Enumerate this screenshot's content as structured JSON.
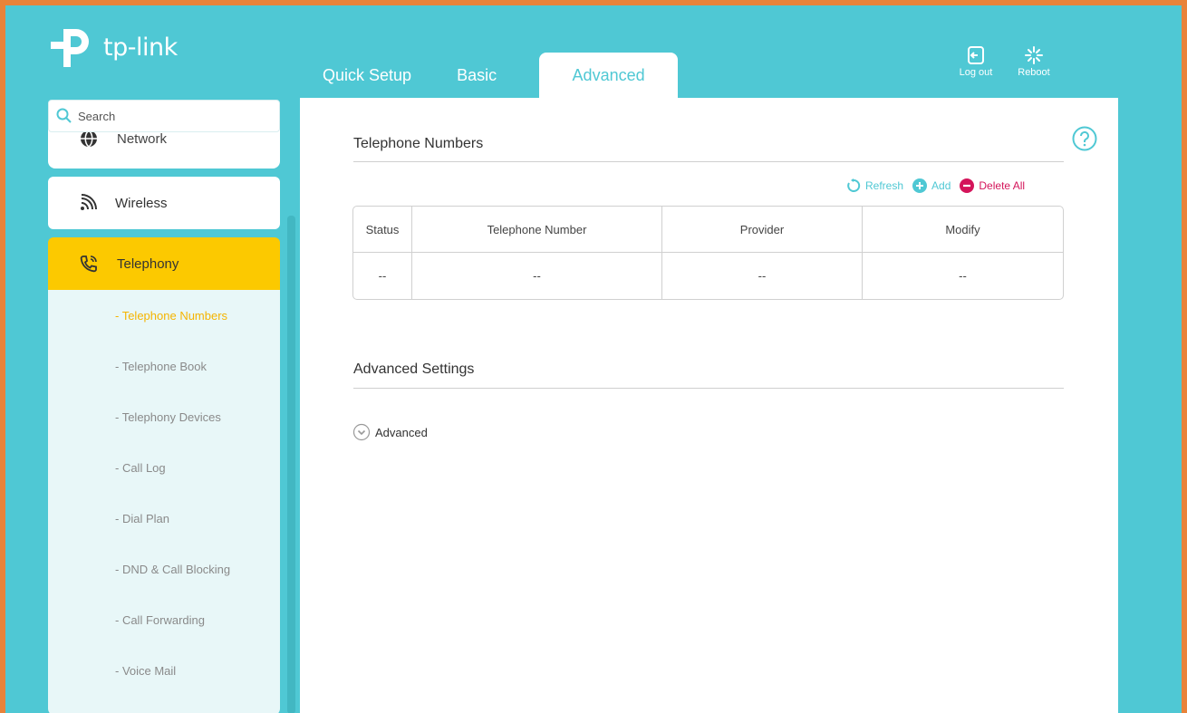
{
  "brand": {
    "name": "tp-link",
    "accent": "#4fc8d4",
    "highlight": "#fcc900",
    "frame": "#e8833a"
  },
  "tabs": [
    {
      "label": "Quick Setup",
      "active": false
    },
    {
      "label": "Basic",
      "active": false
    },
    {
      "label": "Advanced",
      "active": true
    }
  ],
  "top_actions": {
    "logout": "Log out",
    "reboot": "Reboot"
  },
  "search": {
    "placeholder": "Search"
  },
  "sidebar": {
    "items": [
      {
        "label": "Network",
        "icon": "globe-icon"
      },
      {
        "label": "Wireless",
        "icon": "wifi-icon"
      },
      {
        "label": "Telephony",
        "icon": "phone-icon",
        "active": true
      }
    ],
    "submenu": [
      {
        "label": "- Telephone Numbers",
        "active": true
      },
      {
        "label": "- Telephone Book"
      },
      {
        "label": "- Telephony Devices"
      },
      {
        "label": "- Call Log"
      },
      {
        "label": "- Dial Plan"
      },
      {
        "label": "- DND & Call Blocking"
      },
      {
        "label": "- Call Forwarding"
      },
      {
        "label": "- Voice Mail"
      }
    ]
  },
  "main": {
    "section1_title": "Telephone Numbers",
    "actions": {
      "refresh": "Refresh",
      "add": "Add",
      "delete_all": "Delete All"
    },
    "table": {
      "headers": [
        "Status",
        "Telephone Number",
        "Provider",
        "Modify"
      ],
      "rows": [
        [
          "--",
          "--",
          "--",
          "--"
        ]
      ]
    },
    "section2_title": "Advanced Settings",
    "advanced_toggle": "Advanced"
  }
}
